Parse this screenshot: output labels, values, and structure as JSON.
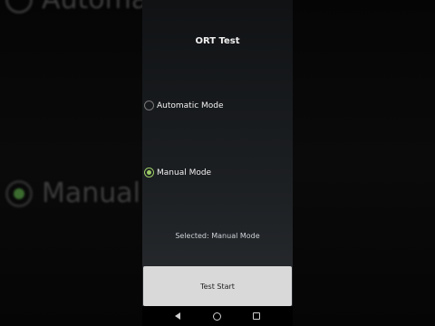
{
  "app": {
    "title": "ORT Test"
  },
  "background": {
    "auto_label": "Automatic Mode",
    "manual_label": "Manual M"
  },
  "options": [
    {
      "label": "Automatic Mode",
      "checked": false
    },
    {
      "label": "Manual Mode",
      "checked": true
    }
  ],
  "status": {
    "selected_text": "Selected: Manual Mode"
  },
  "button": {
    "start_label": "Test Start"
  },
  "nav": {
    "icons": [
      "back-icon",
      "home-icon",
      "recents-icon"
    ]
  },
  "colors": {
    "accent": "#9ccc65",
    "button_bg": "#d9d9d9"
  }
}
